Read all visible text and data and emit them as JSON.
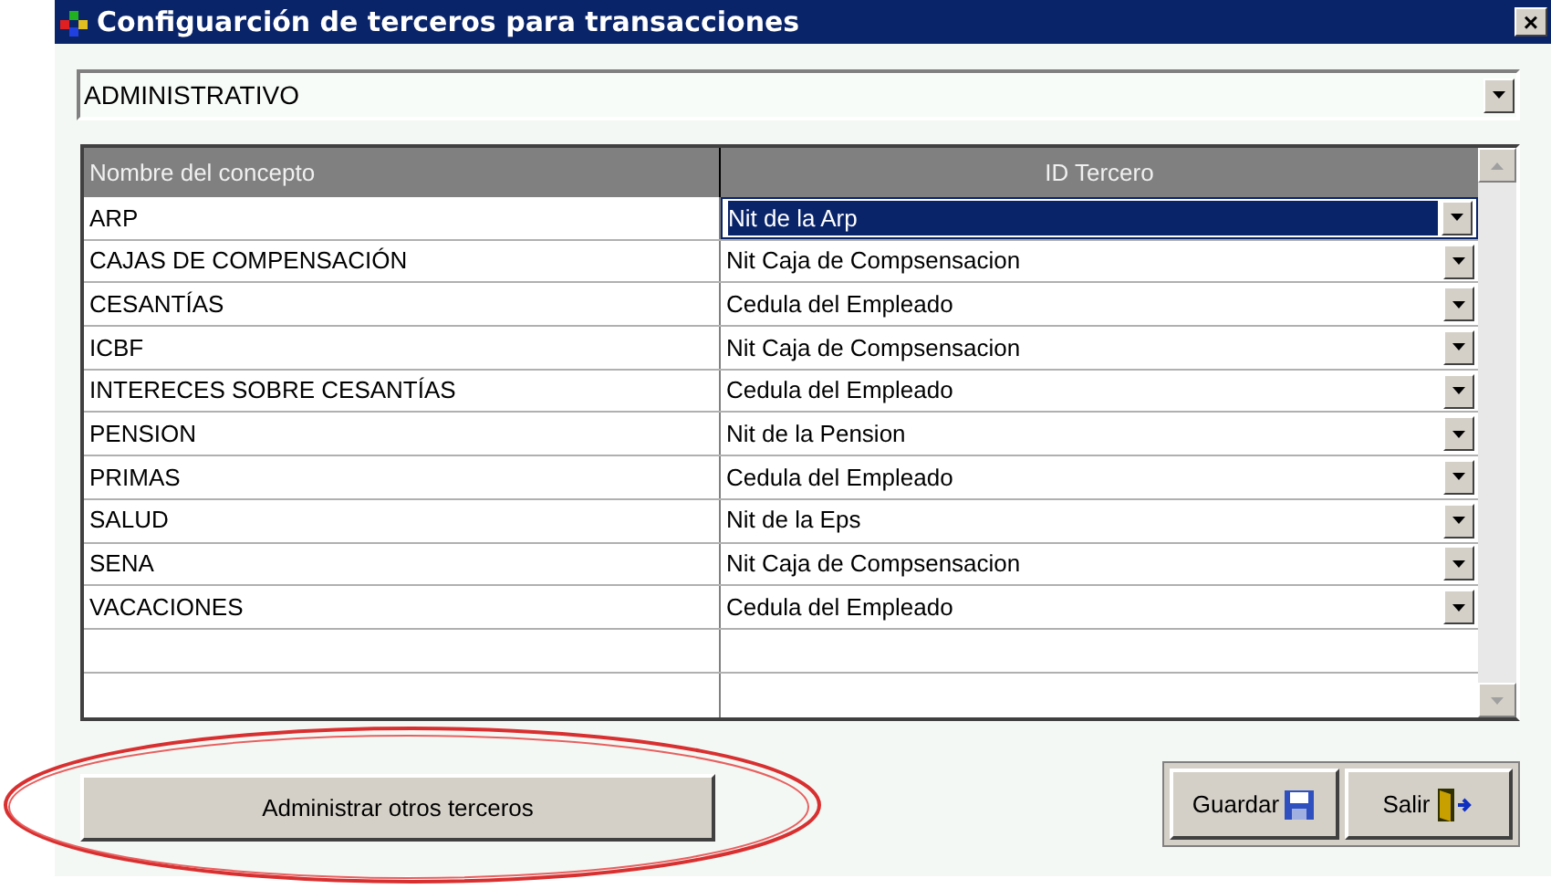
{
  "window": {
    "title": "Configuarción de terceros para transacciones",
    "close": "×"
  },
  "category": {
    "value": "ADMINISTRATIVO"
  },
  "table": {
    "columns": [
      "Nombre del concepto",
      "ID Tercero"
    ],
    "rows": [
      {
        "concept": "ARP",
        "third_party": "Nit de la Arp",
        "selected": true
      },
      {
        "concept": "CAJAS DE COMPENSACIÓN",
        "third_party": "Nit Caja de Compsensacion",
        "selected": false
      },
      {
        "concept": "CESANTÍAS",
        "third_party": "Cedula del Empleado",
        "selected": false
      },
      {
        "concept": "ICBF",
        "third_party": "Nit Caja de Compsensacion",
        "selected": false
      },
      {
        "concept": "INTERECES SOBRE CESANTÍAS",
        "third_party": "Cedula del Empleado",
        "selected": false
      },
      {
        "concept": "PENSION",
        "third_party": "Nit de la Pension",
        "selected": false
      },
      {
        "concept": "PRIMAS",
        "third_party": "Cedula del Empleado",
        "selected": false
      },
      {
        "concept": "SALUD",
        "third_party": "Nit de la Eps",
        "selected": false
      },
      {
        "concept": "SENA",
        "third_party": "Nit Caja de Compsensacion",
        "selected": false
      },
      {
        "concept": "VACACIONES",
        "third_party": "Cedula del Empleado",
        "selected": false
      }
    ]
  },
  "buttons": {
    "manage": "Administrar otros terceros",
    "save": "Guardar",
    "exit": "Salir"
  }
}
